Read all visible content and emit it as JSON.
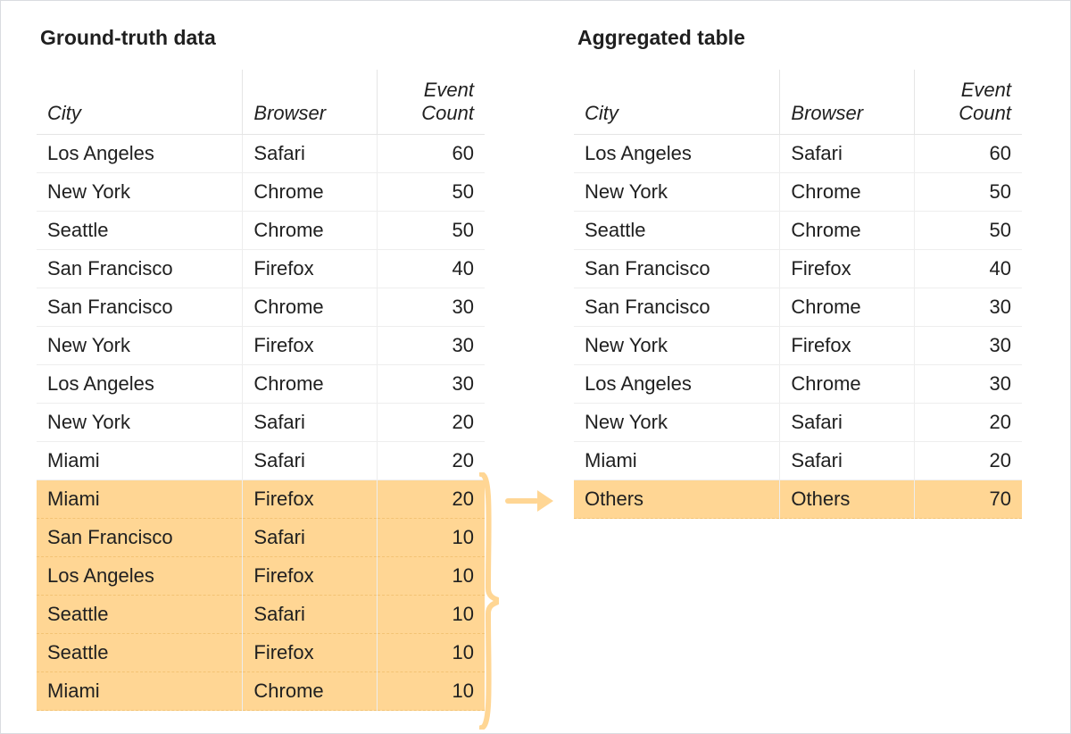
{
  "left": {
    "title": "Ground-truth data",
    "headers": {
      "city": "City",
      "browser": "Browser",
      "count": "Event Count"
    },
    "rows": [
      {
        "city": "Los Angeles",
        "browser": "Safari",
        "count": 60,
        "hi": false
      },
      {
        "city": "New York",
        "browser": "Chrome",
        "count": 50,
        "hi": false
      },
      {
        "city": "Seattle",
        "browser": "Chrome",
        "count": 50,
        "hi": false
      },
      {
        "city": "San Francisco",
        "browser": "Firefox",
        "count": 40,
        "hi": false
      },
      {
        "city": "San Francisco",
        "browser": "Chrome",
        "count": 30,
        "hi": false
      },
      {
        "city": "New York",
        "browser": "Firefox",
        "count": 30,
        "hi": false
      },
      {
        "city": "Los Angeles",
        "browser": "Chrome",
        "count": 30,
        "hi": false
      },
      {
        "city": "New York",
        "browser": "Safari",
        "count": 20,
        "hi": false
      },
      {
        "city": "Miami",
        "browser": "Safari",
        "count": 20,
        "hi": false
      },
      {
        "city": "Miami",
        "browser": "Firefox",
        "count": 20,
        "hi": true
      },
      {
        "city": "San Francisco",
        "browser": "Safari",
        "count": 10,
        "hi": true
      },
      {
        "city": "Los Angeles",
        "browser": "Firefox",
        "count": 10,
        "hi": true
      },
      {
        "city": "Seattle",
        "browser": "Safari",
        "count": 10,
        "hi": true
      },
      {
        "city": "Seattle",
        "browser": "Firefox",
        "count": 10,
        "hi": true
      },
      {
        "city": "Miami",
        "browser": "Chrome",
        "count": 10,
        "hi": true
      }
    ]
  },
  "right": {
    "title": "Aggregated table",
    "headers": {
      "city": "City",
      "browser": "Browser",
      "count": "Event Count"
    },
    "rows": [
      {
        "city": "Los Angeles",
        "browser": "Safari",
        "count": 60,
        "hi": false
      },
      {
        "city": "New York",
        "browser": "Chrome",
        "count": 50,
        "hi": false
      },
      {
        "city": "Seattle",
        "browser": "Chrome",
        "count": 50,
        "hi": false
      },
      {
        "city": "San Francisco",
        "browser": "Firefox",
        "count": 40,
        "hi": false
      },
      {
        "city": "San Francisco",
        "browser": "Chrome",
        "count": 30,
        "hi": false
      },
      {
        "city": "New York",
        "browser": "Firefox",
        "count": 30,
        "hi": false
      },
      {
        "city": "Los Angeles",
        "browser": "Chrome",
        "count": 30,
        "hi": false
      },
      {
        "city": "New York",
        "browser": "Safari",
        "count": 20,
        "hi": false
      },
      {
        "city": "Miami",
        "browser": "Safari",
        "count": 20,
        "hi": false
      },
      {
        "city": "Others",
        "browser": "Others",
        "count": 70,
        "hi": true
      }
    ]
  },
  "colors": {
    "highlight": "#ffd694"
  }
}
